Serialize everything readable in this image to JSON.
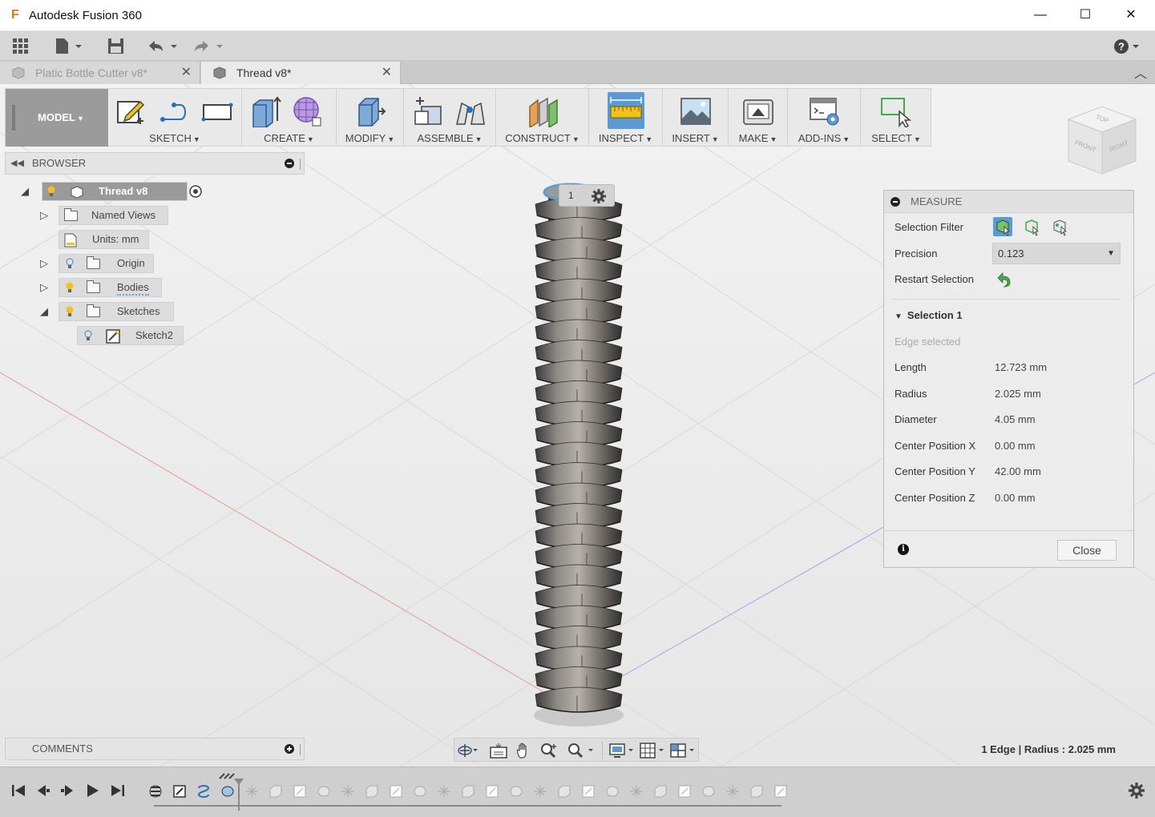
{
  "window": {
    "app_title": "Autodesk Fusion 360",
    "minimize": "—",
    "maximize": "☐",
    "close": "✕"
  },
  "tabs": [
    {
      "label": "Platic Bottle Cutter v8*",
      "active": false
    },
    {
      "label": "Thread v8*",
      "active": true
    }
  ],
  "toolbar": {
    "workspace": "MODEL",
    "groups": [
      "SKETCH",
      "CREATE",
      "MODIFY",
      "ASSEMBLE",
      "CONSTRUCT",
      "INSPECT",
      "INSERT",
      "MAKE",
      "ADD-INS",
      "SELECT"
    ]
  },
  "browser": {
    "title": "BROWSER",
    "root": "Thread v8",
    "items": [
      "Named Views",
      "Units: mm",
      "Origin",
      "Bodies",
      "Sketches",
      "Sketch2"
    ]
  },
  "comments": {
    "title": "COMMENTS"
  },
  "viewcube": {
    "top": "TOP",
    "front": "FRONT",
    "right": "RIGHT"
  },
  "selection_badge": "1",
  "measure": {
    "title": "MEASURE",
    "selection_filter_label": "Selection Filter",
    "precision_label": "Precision",
    "precision_value": "0.123",
    "restart_label": "Restart Selection",
    "selection_header": "Selection 1",
    "edge_selected": "Edge selected",
    "rows": [
      {
        "label": "Length",
        "value": "12.723 mm"
      },
      {
        "label": "Radius",
        "value": "2.025 mm"
      },
      {
        "label": "Diameter",
        "value": "4.05 mm"
      },
      {
        "label": "Center Position X",
        "value": "0.00 mm"
      },
      {
        "label": "Center Position Y",
        "value": "42.00 mm"
      },
      {
        "label": "Center Position Z",
        "value": "0.00 mm"
      }
    ],
    "close_label": "Close",
    "info_glyph": "i"
  },
  "status": "1 Edge | Radius : 2.025 mm",
  "colors": {
    "accent_blue": "#5a9bd5",
    "bulb_yellow": "#f2c21b",
    "model_gray": "#9b9b9b"
  }
}
